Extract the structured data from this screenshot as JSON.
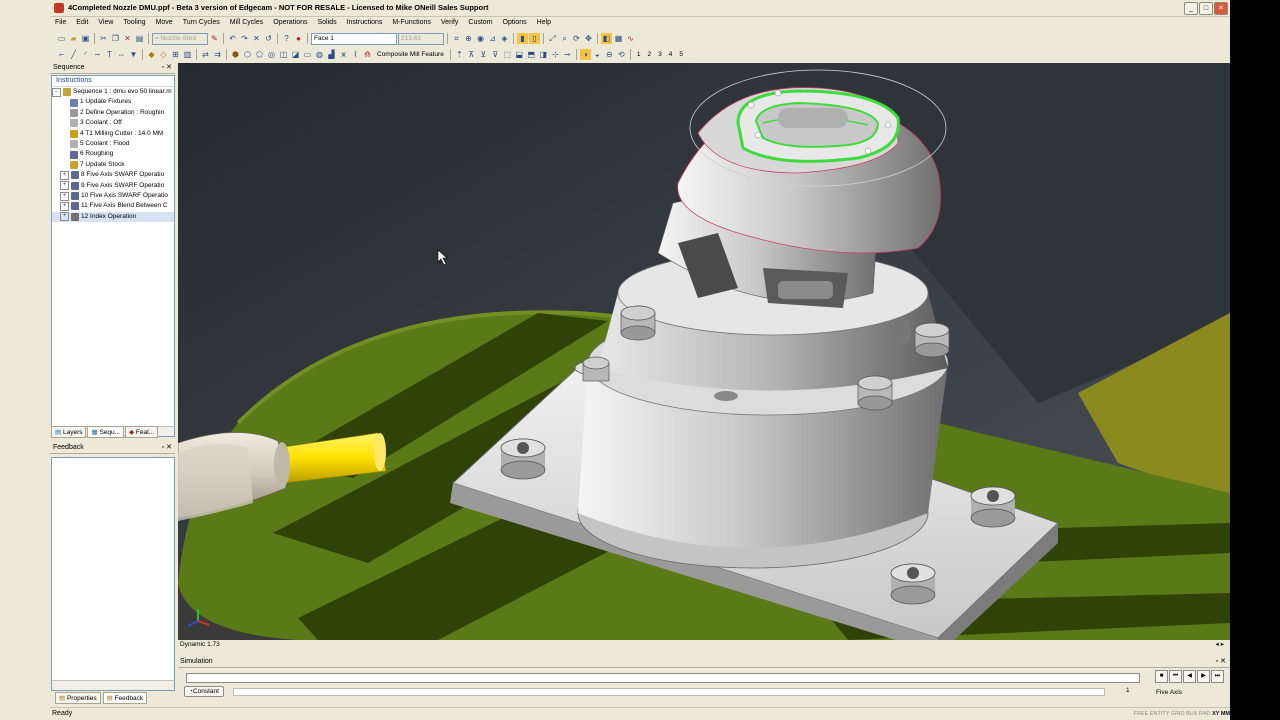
{
  "window": {
    "title": "4Completed Nozzle DMU.ppf - Beta 3 version of Edgecam - NOT FOR RESALE - Licensed to Mike ONeill Sales Support"
  },
  "menu": [
    "File",
    "Edit",
    "View",
    "Tooling",
    "Move",
    "Turn Cycles",
    "Mill Cycles",
    "Operations",
    "Solids",
    "Instructions",
    "M-Functions",
    "Verify",
    "Custom",
    "Options",
    "Help"
  ],
  "toolbar": {
    "layer_combo": "= Nozzle-Stnd",
    "face_combo": "Face 1",
    "value_combo": "213.63",
    "composite_label": "Composite Mill Feature",
    "numbers": [
      "1",
      "2",
      "3",
      "4",
      "5"
    ]
  },
  "sequence_panel": {
    "title": "Sequence",
    "instructions_header": "Instructions",
    "items": [
      "Sequence 1 : dmu evo 50 linear.m",
      "1 Update Fixtures",
      "2 Define Operation : Roughin",
      "3 Coolant : Off",
      "4 T1 Milling Cutter : 14.0 MM",
      "5 Coolant : Flood",
      "6 Roughing",
      "7 Update Stock",
      "8 Five Axis SWARF Operatio",
      "9 Five Axis SWARF Operatio",
      "10 Five Axis SWARF Operatio",
      "11 Five Axis Blend Between C",
      "12 Index Operation"
    ],
    "tabs": [
      "Layers",
      "Sequ...",
      "Feat..."
    ]
  },
  "feedback_panel": {
    "title": "Feedback"
  },
  "bottom_tabs": [
    "Properties",
    "Feedback"
  ],
  "viewport": {
    "status": "Dynamic 1.73"
  },
  "simulation": {
    "title": "Simulation",
    "mode_button": "Constant",
    "speed_value": "1",
    "mode_label": "Five Axis"
  },
  "status": {
    "text": "Ready",
    "right_dim": "FREE ENTITY GRID BUS RAD",
    "right_bold": "XY MM"
  },
  "colors": {
    "table_green": "#5a7a18",
    "highlight_green": "#3ddc3d",
    "tool_yellow": "#ffe100",
    "background_slate": "#3b4147"
  }
}
